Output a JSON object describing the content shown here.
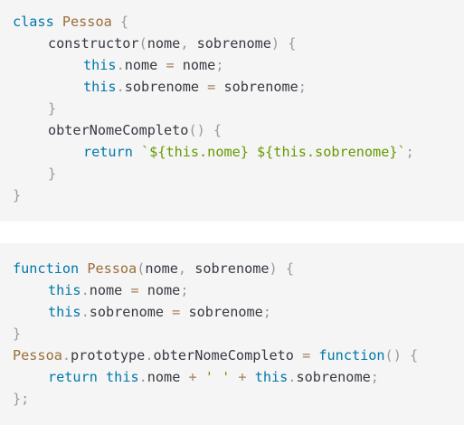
{
  "snippets": [
    {
      "name": "class-example",
      "lines": [
        {
          "indent": 0,
          "tokens": [
            {
              "t": "kw",
              "v": "class"
            },
            {
              "t": "plain",
              "v": " "
            },
            {
              "t": "name",
              "v": "Pessoa"
            },
            {
              "t": "plain",
              "v": " "
            },
            {
              "t": "punc",
              "v": "{"
            }
          ]
        },
        {
          "indent": 1,
          "tokens": [
            {
              "t": "plain",
              "v": "constructor"
            },
            {
              "t": "punc",
              "v": "("
            },
            {
              "t": "plain",
              "v": "nome"
            },
            {
              "t": "punc",
              "v": ","
            },
            {
              "t": "plain",
              "v": " sobrenome"
            },
            {
              "t": "punc",
              "v": ")"
            },
            {
              "t": "plain",
              "v": " "
            },
            {
              "t": "punc",
              "v": "{"
            }
          ]
        },
        {
          "indent": 2,
          "tokens": [
            {
              "t": "kw",
              "v": "this"
            },
            {
              "t": "punc",
              "v": "."
            },
            {
              "t": "plain",
              "v": "nome "
            },
            {
              "t": "op",
              "v": "="
            },
            {
              "t": "plain",
              "v": " nome"
            },
            {
              "t": "punc",
              "v": ";"
            }
          ]
        },
        {
          "indent": 2,
          "tokens": [
            {
              "t": "kw",
              "v": "this"
            },
            {
              "t": "punc",
              "v": "."
            },
            {
              "t": "plain",
              "v": "sobrenome "
            },
            {
              "t": "op",
              "v": "="
            },
            {
              "t": "plain",
              "v": " sobrenome"
            },
            {
              "t": "punc",
              "v": ";"
            }
          ]
        },
        {
          "indent": 1,
          "tokens": [
            {
              "t": "punc",
              "v": "}"
            }
          ]
        },
        {
          "indent": 1,
          "tokens": [
            {
              "t": "plain",
              "v": "obterNomeCompleto"
            },
            {
              "t": "punc",
              "v": "()"
            },
            {
              "t": "plain",
              "v": " "
            },
            {
              "t": "punc",
              "v": "{"
            }
          ]
        },
        {
          "indent": 2,
          "tokens": [
            {
              "t": "kw",
              "v": "return"
            },
            {
              "t": "plain",
              "v": " "
            },
            {
              "t": "str",
              "v": "`${this.nome} ${this.sobrenome}`"
            },
            {
              "t": "punc",
              "v": ";"
            }
          ]
        },
        {
          "indent": 1,
          "tokens": [
            {
              "t": "punc",
              "v": "}"
            }
          ]
        },
        {
          "indent": 0,
          "tokens": [
            {
              "t": "punc",
              "v": "}"
            }
          ]
        }
      ]
    },
    {
      "name": "function-example",
      "lines": [
        {
          "indent": 0,
          "tokens": [
            {
              "t": "kw",
              "v": "function"
            },
            {
              "t": "plain",
              "v": " "
            },
            {
              "t": "name",
              "v": "Pessoa"
            },
            {
              "t": "punc",
              "v": "("
            },
            {
              "t": "plain",
              "v": "nome"
            },
            {
              "t": "punc",
              "v": ","
            },
            {
              "t": "plain",
              "v": " sobrenome"
            },
            {
              "t": "punc",
              "v": ")"
            },
            {
              "t": "plain",
              "v": " "
            },
            {
              "t": "punc",
              "v": "{"
            }
          ]
        },
        {
          "indent": 1,
          "tokens": [
            {
              "t": "kw",
              "v": "this"
            },
            {
              "t": "punc",
              "v": "."
            },
            {
              "t": "plain",
              "v": "nome "
            },
            {
              "t": "op",
              "v": "="
            },
            {
              "t": "plain",
              "v": " nome"
            },
            {
              "t": "punc",
              "v": ";"
            }
          ]
        },
        {
          "indent": 1,
          "tokens": [
            {
              "t": "kw",
              "v": "this"
            },
            {
              "t": "punc",
              "v": "."
            },
            {
              "t": "plain",
              "v": "sobrenome "
            },
            {
              "t": "op",
              "v": "="
            },
            {
              "t": "plain",
              "v": " sobrenome"
            },
            {
              "t": "punc",
              "v": ";"
            }
          ]
        },
        {
          "indent": 0,
          "tokens": [
            {
              "t": "punc",
              "v": "}"
            }
          ]
        },
        {
          "indent": 0,
          "tokens": [
            {
              "t": "name",
              "v": "Pessoa"
            },
            {
              "t": "punc",
              "v": "."
            },
            {
              "t": "plain",
              "v": "prototype"
            },
            {
              "t": "punc",
              "v": "."
            },
            {
              "t": "plain",
              "v": "obterNomeCompleto "
            },
            {
              "t": "op",
              "v": "="
            },
            {
              "t": "plain",
              "v": " "
            },
            {
              "t": "kw",
              "v": "function"
            },
            {
              "t": "punc",
              "v": "()"
            },
            {
              "t": "plain",
              "v": " "
            },
            {
              "t": "punc",
              "v": "{"
            }
          ]
        },
        {
          "indent": 1,
          "tokens": [
            {
              "t": "kw",
              "v": "return"
            },
            {
              "t": "plain",
              "v": " "
            },
            {
              "t": "kw",
              "v": "this"
            },
            {
              "t": "punc",
              "v": "."
            },
            {
              "t": "plain",
              "v": "nome "
            },
            {
              "t": "op",
              "v": "+"
            },
            {
              "t": "plain",
              "v": " "
            },
            {
              "t": "str",
              "v": "' '"
            },
            {
              "t": "plain",
              "v": " "
            },
            {
              "t": "op",
              "v": "+"
            },
            {
              "t": "plain",
              "v": " "
            },
            {
              "t": "kw",
              "v": "this"
            },
            {
              "t": "punc",
              "v": "."
            },
            {
              "t": "plain",
              "v": "sobrenome"
            },
            {
              "t": "punc",
              "v": ";"
            }
          ]
        },
        {
          "indent": 0,
          "tokens": [
            {
              "t": "punc",
              "v": "};"
            }
          ]
        }
      ]
    }
  ],
  "colors": {
    "background": "#f5f5f5",
    "keyword": "#0077aa",
    "class_name": "#9a6e3a",
    "punctuation": "#999999",
    "text": "#383a42",
    "string": "#669900",
    "operator": "#a67f59"
  }
}
